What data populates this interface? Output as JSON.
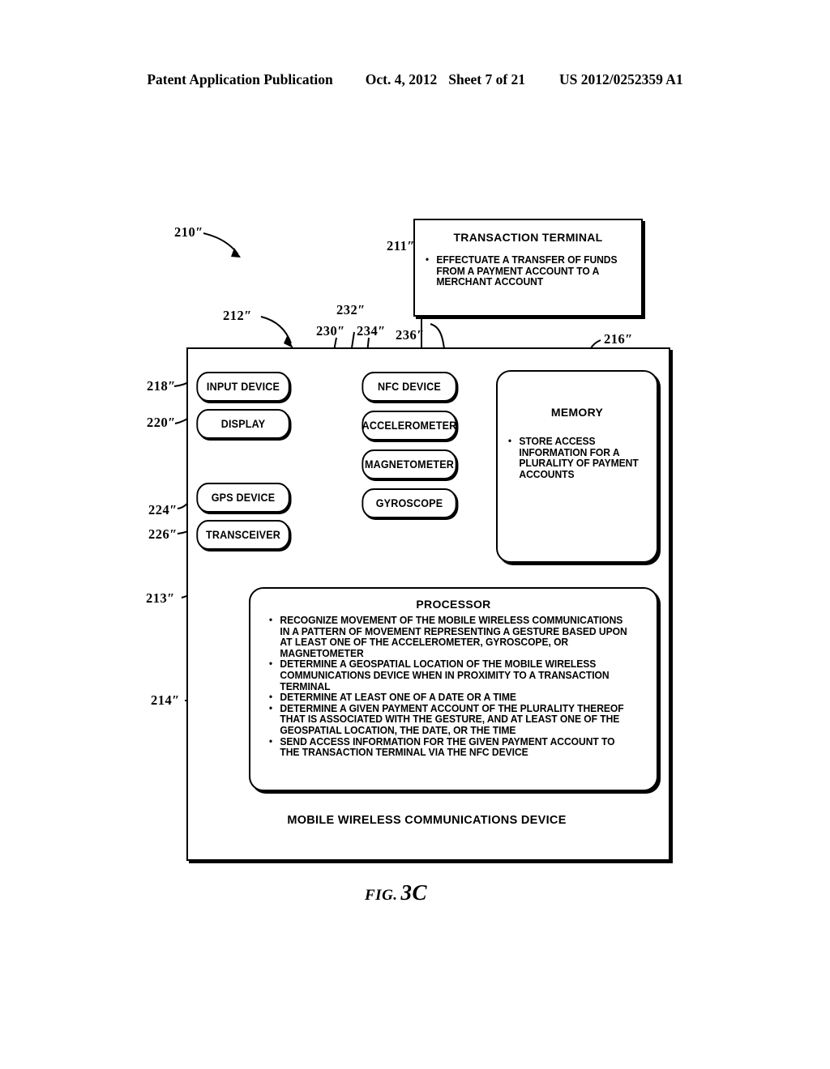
{
  "header": {
    "publication": "Patent Application Publication",
    "date": "Oct. 4, 2012",
    "sheet": "Sheet 7 of 21",
    "patent_number": "US 2012/0252359 A1"
  },
  "figure": {
    "caption_word": "FIG.",
    "caption_number": "3C"
  },
  "refs": {
    "r210": "210″",
    "r211": "211″",
    "r212": "212″",
    "r213": "213″",
    "r214": "214″",
    "r216": "216″",
    "r218": "218″",
    "r220": "220″",
    "r224": "224″",
    "r226": "226″",
    "r230": "230″",
    "r232": "232″",
    "r234": "234″",
    "r236": "236″"
  },
  "transaction_terminal": {
    "title": "TRANSACTION TERMINAL",
    "bullets": [
      "EFFECTUATE A TRANSFER OF FUNDS FROM A PAYMENT ACCOUNT TO A MERCHANT ACCOUNT"
    ]
  },
  "memory": {
    "title": "MEMORY",
    "bullets": [
      "STORE ACCESS INFORMATION FOR A PLURALITY OF PAYMENT ACCOUNTS"
    ]
  },
  "processor": {
    "title": "PROCESSOR",
    "bullets": [
      "RECOGNIZE MOVEMENT OF THE MOBILE WIRELESS COMMUNICATIONS IN A PATTERN OF MOVEMENT REPRESENTING A GESTURE BASED UPON AT LEAST ONE OF THE ACCELEROMETER, GYROSCOPE, OR MAGNETOMETER",
      "DETERMINE A GEOSPATIAL LOCATION OF THE MOBILE WIRELESS COMMUNICATIONS DEVICE WHEN IN PROXIMITY TO A TRANSACTION TERMINAL",
      "DETERMINE AT LEAST ONE OF A DATE OR A TIME",
      "DETERMINE A GIVEN PAYMENT ACCOUNT OF THE PLURALITY THEREOF THAT IS ASSOCIATED WITH THE GESTURE, AND AT LEAST ONE OF THE GEOSPATIAL LOCATION, THE DATE, OR THE TIME",
      "SEND ACCESS INFORMATION FOR THE GIVEN PAYMENT ACCOUNT TO THE TRANSACTION TERMINAL VIA THE NFC DEVICE"
    ]
  },
  "device": {
    "label": "MOBILE WIRELESS COMMUNICATIONS DEVICE"
  },
  "nodes": {
    "input_device": "INPUT DEVICE",
    "display": "DISPLAY",
    "gps_device": "GPS DEVICE",
    "transceiver": "TRANSCEIVER",
    "nfc_device": "NFC DEVICE",
    "accelerometer": "ACCELEROMETER",
    "magnetometer": "MAGNETOMETER",
    "gyroscope": "GYROSCOPE"
  }
}
